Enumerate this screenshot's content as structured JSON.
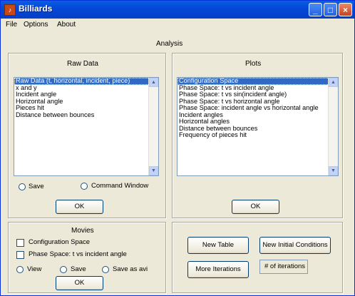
{
  "window": {
    "title": "Billiards",
    "icon": "matlab-icon"
  },
  "menu": [
    "File",
    "Options",
    "About"
  ],
  "heading": "Analysis",
  "raw": {
    "title": "Raw Data",
    "items": [
      "Raw Data (t, horizontal, incident, piece)",
      "x and y",
      "Incident angle",
      "Horizontal angle",
      "Pieces hit",
      "Distance between bounces"
    ],
    "selected": 0,
    "save_label": "Save",
    "command_label": "Command Window",
    "ok_label": "OK"
  },
  "plots": {
    "title": "Plots",
    "items": [
      "Configuration Space",
      "Phase Space:  t vs incident angle",
      "Phase Space:  t vs sin(incident angle)",
      "Phase Space:  t vs horizontal angle",
      "Phase Space:  incident angle vs horizontal angle",
      "Incident angles",
      "Horizontal angles",
      "Distance between bounces",
      "Frequency of pieces hit"
    ],
    "selected": 0,
    "ok_label": "OK"
  },
  "movies": {
    "title": "Movies",
    "check1": "Configuration Space",
    "check2": "Phase Space:  t vs incident angle",
    "view_label": "View",
    "save_label": "Save",
    "saveavi_label": "Save as avi",
    "ok_label": "OK"
  },
  "actions": {
    "new_table": "New Table",
    "new_initial": "New Initial Conditions",
    "more_iterations": "More Iterations",
    "iterations_field": "# of iterations"
  }
}
